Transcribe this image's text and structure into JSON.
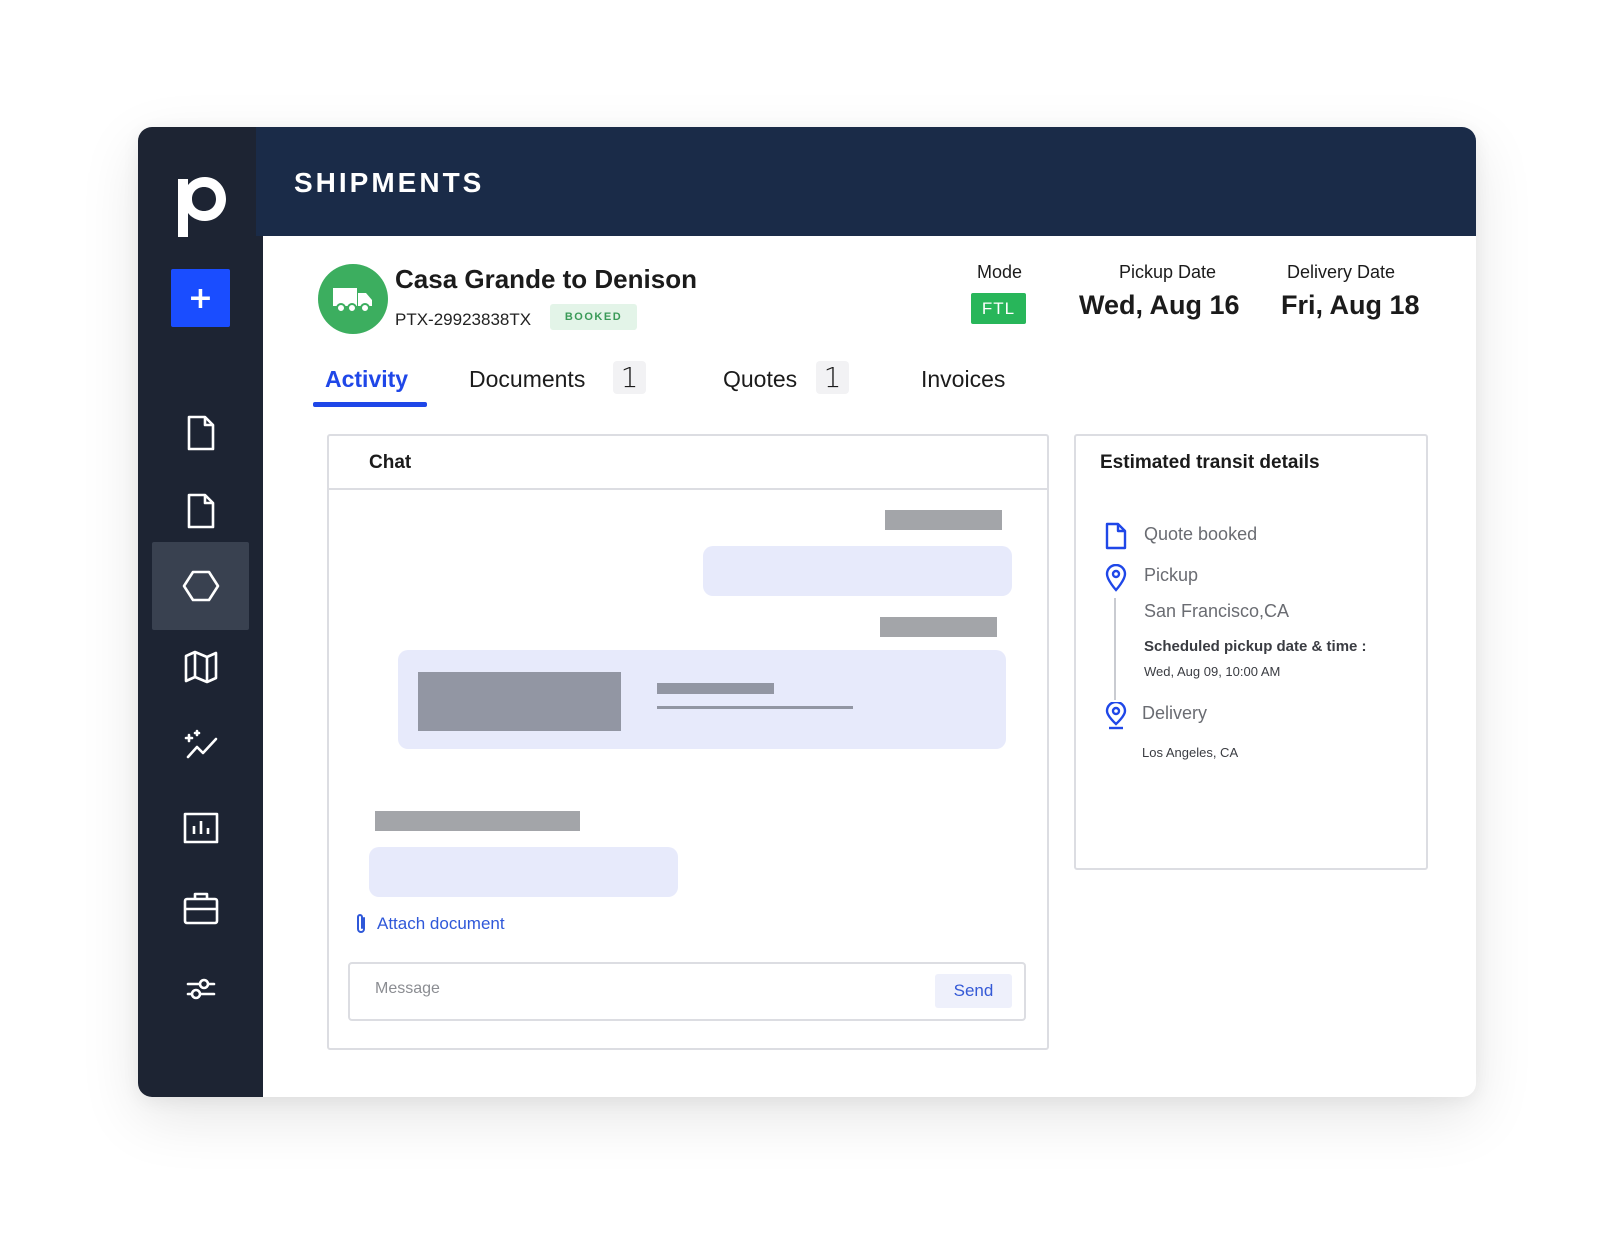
{
  "header": {
    "title": "SHIPMENTS"
  },
  "sidebar": {
    "add_label": "+",
    "items": [
      {
        "name": "document-icon"
      },
      {
        "name": "document-icon"
      },
      {
        "name": "hexagon-icon",
        "active": true
      },
      {
        "name": "map-icon"
      },
      {
        "name": "sparkle-trend-icon"
      },
      {
        "name": "bar-chart-icon"
      },
      {
        "name": "briefcase-icon"
      },
      {
        "name": "sliders-icon"
      }
    ]
  },
  "shipment": {
    "title": "Casa Grande to Denison",
    "id": "PTX-29923838TX",
    "status": "BOOKED",
    "mode_label": "Mode",
    "mode": "FTL",
    "pickup_label": "Pickup Date",
    "pickup": "Wed, Aug 16",
    "delivery_label": "Delivery Date",
    "delivery": "Fri, Aug 18"
  },
  "tabs": [
    {
      "label": "Activity",
      "active": true
    },
    {
      "label": "Documents",
      "count": "1"
    },
    {
      "label": "Quotes",
      "count": "1"
    },
    {
      "label": "Invoices"
    }
  ],
  "chat": {
    "title": "Chat",
    "attach_label": "Attach document",
    "message_placeholder": "Message",
    "send_label": "Send"
  },
  "transit": {
    "title": "Estimated transit details",
    "quote_booked": "Quote booked",
    "pickup_label": "Pickup",
    "pickup_location": "San Francisco,CA",
    "scheduled_label": "Scheduled pickup date & time :",
    "scheduled_value": "Wed, Aug 09, 10:00 AM",
    "delivery_label": "Delivery",
    "delivery_location": "Los Angeles, CA"
  },
  "colors": {
    "sidebar": "#1d2433",
    "header": "#1a2b48",
    "accent": "#1f47e8",
    "success": "#28b65a"
  }
}
